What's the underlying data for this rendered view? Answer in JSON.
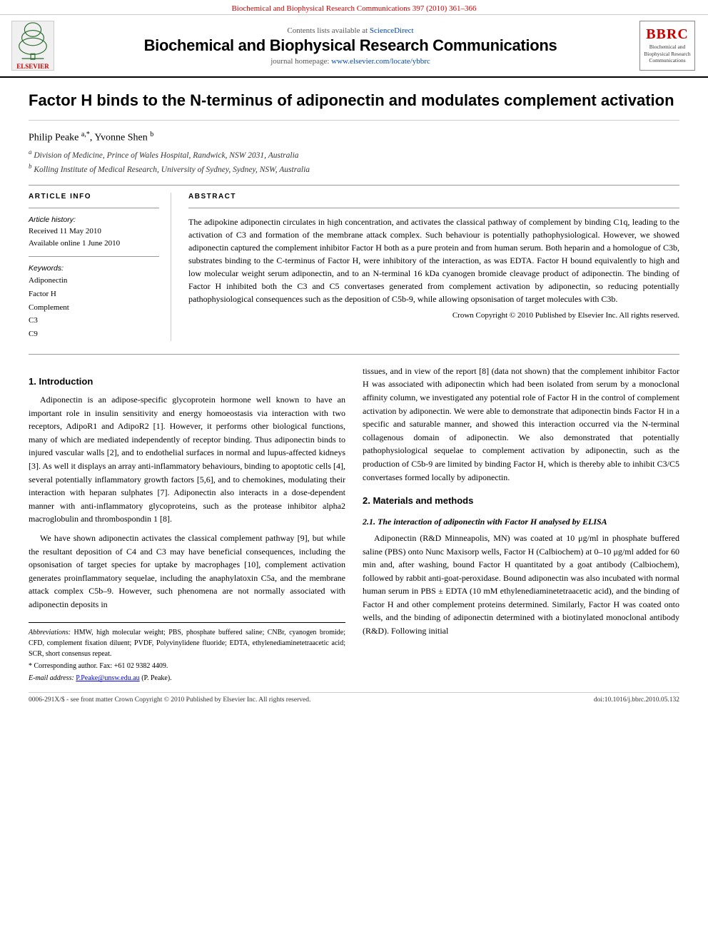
{
  "topbar": {
    "text": "Biochemical and Biophysical Research Communications 397 (2010) 361–366"
  },
  "journal_header": {
    "contents_line": "Contents lists available at",
    "sciencedirect_link": "ScienceDirect",
    "journal_title": "Biochemical and Biophysical Research Communications",
    "homepage_label": "journal homepage:",
    "homepage_url": "www.elsevier.com/locate/ybbrc",
    "bbrc_letters": "BBRC",
    "bbrc_subtitle": "Biochemical and Biophysical Research Communications"
  },
  "article": {
    "title": "Factor H binds to the N-terminus of adiponectin and modulates complement activation",
    "authors": "Philip Peake a,*, Yvonne Shen b",
    "affiliation_a": "Division of Medicine, Prince of Wales Hospital, Randwick, NSW 2031, Australia",
    "affiliation_b": "Kolling Institute of Medical Research, University of Sydney, Sydney, NSW, Australia",
    "article_info": {
      "section_title": "ARTICLE INFO",
      "history_label": "Article history:",
      "received": "Received 11 May 2010",
      "available_online": "Available online 1 June 2010",
      "keywords_label": "Keywords:",
      "keywords": [
        "Adiponectin",
        "Factor H",
        "Complement",
        "C3",
        "C9"
      ]
    },
    "abstract": {
      "section_title": "ABSTRACT",
      "text": "The adipokine adiponectin circulates in high concentration, and activates the classical pathway of complement by binding C1q, leading to the activation of C3 and formation of the membrane attack complex. Such behaviour is potentially pathophysiological. However, we showed adiponectin captured the complement inhibitor Factor H both as a pure protein and from human serum. Both heparin and a homologue of C3b, substrates binding to the C-terminus of Factor H, were inhibitory of the interaction, as was EDTA. Factor H bound equivalently to high and low molecular weight serum adiponectin, and to an N-terminal 16 kDa cyanogen bromide cleavage product of adiponectin. The binding of Factor H inhibited both the C3 and C5 convertases generated from complement activation by adiponectin, so reducing potentially pathophysiological consequences such as the deposition of C5b-9, while allowing opsonisation of target molecules with C3b.",
      "copyright": "Crown Copyright © 2010 Published by Elsevier Inc. All rights reserved."
    },
    "section1": {
      "heading": "1. Introduction",
      "para1": "Adiponectin is an adipose-specific glycoprotein hormone well known to have an important role in insulin sensitivity and energy homoeostasis via interaction with two receptors, AdipoR1 and AdipoR2 [1]. However, it performs other biological functions, many of which are mediated independently of receptor binding. Thus adiponectin binds to injured vascular walls [2], and to endothelial surfaces in normal and lupus-affected kidneys [3]. As well it displays an array anti-inflammatory behaviours, binding to apoptotic cells [4], several potentially inflammatory growth factors [5,6], and to chemokines, modulating their interaction with heparan sulphates [7]. Adiponectin also interacts in a dose-dependent manner with anti-inflammatory glycoproteins, such as the protease inhibitor alpha2 macroglobulin and thrombospondin 1 [8].",
      "para2": "We have shown adiponectin activates the classical complement pathway [9], but while the resultant deposition of C4 and C3 may have beneficial consequences, including the opsonisation of target species for uptake by macrophages [10], complement activation generates proinflammatory sequelae, including the anaphylatoxin C5a, and the membrane attack complex C5b–9. However, such phenomena are not normally associated with adiponectin deposits in"
    },
    "section1_right": {
      "para1": "tissues, and in view of the report [8] (data not shown) that the complement inhibitor Factor H was associated with adiponectin which had been isolated from serum by a monoclonal affinity column, we investigated any potential role of Factor H in the control of complement activation by adiponectin. We were able to demonstrate that adiponectin binds Factor H in a specific and saturable manner, and showed this interaction occurred via the N-terminal collagenous domain of adiponectin. We also demonstrated that potentially pathophysiological sequelae to complement activation by adiponectin, such as the production of C5b-9 are limited by binding Factor H, which is thereby able to inhibit C3/C5 convertases formed locally by adiponectin."
    },
    "section2": {
      "heading": "2. Materials and methods",
      "subsection_heading": "2.1. The interaction of adiponectin with Factor H analysed by ELISA",
      "para1": "Adiponectin (R&D Minneapolis, MN) was coated at 10 μg/ml in phosphate buffered saline (PBS) onto Nunc Maxisorp wells, Factor H (Calbiochem) at 0–10 μg/ml added for 60 min and, after washing, bound Factor H quantitated by a goat antibody (Calbiochem), followed by rabbit anti-goat-peroxidase. Bound adiponectin was also incubated with normal human serum in PBS ± EDTA (10 mM ethylenediaminetetraacetic acid), and the binding of Factor H and other complement proteins determined. Similarly, Factor H was coated onto wells, and the binding of adiponectin determined with a biotinylated monoclonal antibody (R&D). Following initial"
    },
    "footnotes": {
      "abbreviations": "Abbreviations: HMW, high molecular weight; PBS, phosphate buffered saline; CNBr, cyanogen bromide; CFD, complement fixation diluent; PVDF, Polyvinylidene fluoride; EDTA, ethylenediaminetetraacetic acid; SCR, short consensus repeat.",
      "corresponding": "* Corresponding author. Fax: +61 02 9382 4409.",
      "email": "E-mail address: P.Peake@unsw.edu.au (P. Peake)."
    },
    "bottom_bar": {
      "left": "0006-291X/$ - see front matter Crown Copyright © 2010 Published by Elsevier Inc. All rights reserved.",
      "doi": "doi:10.1016/j.bbrc.2010.05.132"
    }
  }
}
